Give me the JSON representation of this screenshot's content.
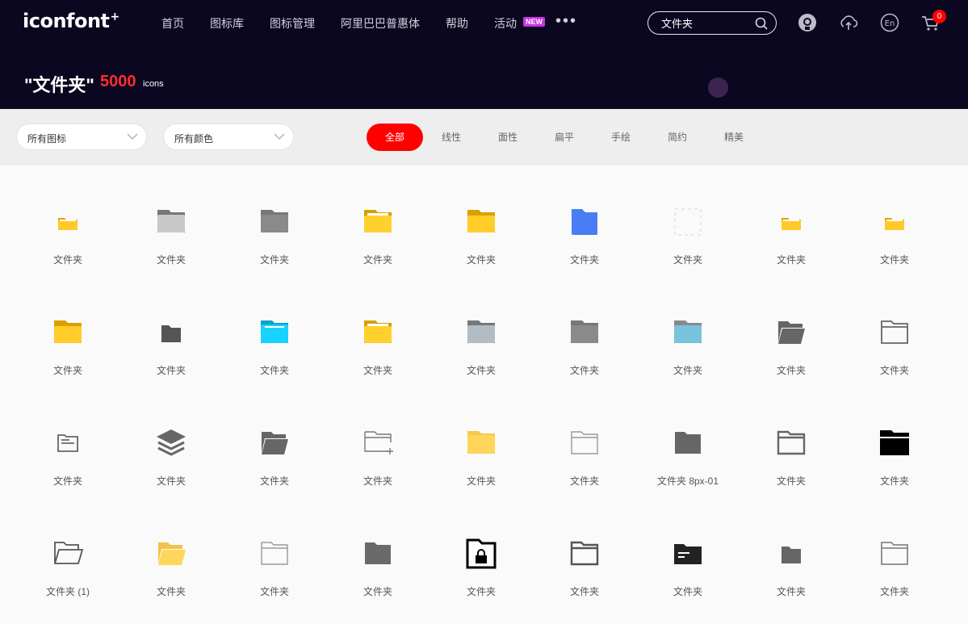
{
  "header": {
    "logo_text": "iconfont",
    "logo_mark": "+",
    "nav": [
      {
        "label": "首页"
      },
      {
        "label": "图标库"
      },
      {
        "label": "图标管理"
      },
      {
        "label": "阿里巴巴普惠体"
      },
      {
        "label": "帮助"
      },
      {
        "label": "活动",
        "badge": "NEW"
      }
    ],
    "more_label": "•••",
    "search": {
      "value": "文件夹",
      "placeholder": ""
    },
    "cart_count": "0",
    "icons": [
      "user-avatar-icon",
      "upload-icon",
      "language-en-icon",
      "cart-icon"
    ]
  },
  "result": {
    "title": "\"文件夹\"",
    "count": "5000",
    "unit": "icons"
  },
  "filters": {
    "icon_select": "所有图标",
    "color_select": "所有颜色",
    "tabs": [
      "全部",
      "线性",
      "面性",
      "扁平",
      "手绘",
      "简约",
      "精美"
    ],
    "active_tab": "全部"
  },
  "icons": [
    {
      "name": "文件夹",
      "icon": "folder-small-yellow",
      "color": "#ffc928"
    },
    {
      "name": "文件夹",
      "icon": "folder-light-gray",
      "color": "#c8c8c8"
    },
    {
      "name": "文件夹",
      "icon": "folder-gray",
      "color": "#8a8a8a"
    },
    {
      "name": "文件夹",
      "icon": "folder-yellow-paper",
      "color": "#ffd12e"
    },
    {
      "name": "文件夹",
      "icon": "folder-yellow",
      "color": "#ffcc29"
    },
    {
      "name": "文件夹",
      "icon": "folder-blue",
      "color": "#4a7df5"
    },
    {
      "name": "文件夹",
      "icon": "folder-transparent",
      "color": "#e8e8e8"
    },
    {
      "name": "文件夹",
      "icon": "folder-small-yellow",
      "color": "#ffc928"
    },
    {
      "name": "文件夹",
      "icon": "folder-small-yellow",
      "color": "#ffc928"
    },
    {
      "name": "文件夹",
      "icon": "folder-yellow-large",
      "color": "#ffcc29"
    },
    {
      "name": "文件夹",
      "icon": "folder-dark-small",
      "color": "#555555"
    },
    {
      "name": "文件夹",
      "icon": "folder-cyan",
      "color": "#18d2ff"
    },
    {
      "name": "文件夹",
      "icon": "folder-yellow-paper",
      "color": "#ffd12e"
    },
    {
      "name": "文件夹",
      "icon": "folder-bluegray",
      "color": "#b2bcc4"
    },
    {
      "name": "文件夹",
      "icon": "folder-gray",
      "color": "#8a8a8a"
    },
    {
      "name": "文件夹",
      "icon": "folder-lightblue",
      "color": "#79c3dd"
    },
    {
      "name": "文件夹",
      "icon": "folder-open-dark",
      "color": "#666666"
    },
    {
      "name": "文件夹",
      "icon": "folder-outline",
      "color": "#666666"
    },
    {
      "name": "文件夹",
      "icon": "folder-doc-outline",
      "color": "#666666"
    },
    {
      "name": "文件夹",
      "icon": "layers",
      "color": "#666666"
    },
    {
      "name": "文件夹",
      "icon": "folder-open-dark",
      "color": "#666666"
    },
    {
      "name": "文件夹",
      "icon": "folder-add-outline",
      "color": "#777777"
    },
    {
      "name": "文件夹",
      "icon": "folder-yellow-soft",
      "color": "#ffd65a"
    },
    {
      "name": "文件夹",
      "icon": "folder-outline-thin",
      "color": "#888888"
    },
    {
      "name": "文件夹 8px-01",
      "icon": "folder-dark-flat",
      "color": "#666666"
    },
    {
      "name": "文件夹",
      "icon": "folder-outline-bold",
      "color": "#666666"
    },
    {
      "name": "文件夹",
      "icon": "folder-black",
      "color": "#000000"
    },
    {
      "name": "文件夹 (1)",
      "icon": "folder-open-outline",
      "color": "#555555"
    },
    {
      "name": "文件夹",
      "icon": "folder-open-yellow",
      "color": "#ffd65a"
    },
    {
      "name": "文件夹",
      "icon": "folder-outline-thin",
      "color": "#888888"
    },
    {
      "name": "文件夹",
      "icon": "folder-dark-flat",
      "color": "#6a6a6a"
    },
    {
      "name": "文件夹",
      "icon": "folder-lock",
      "color": "#000000"
    },
    {
      "name": "文件夹",
      "icon": "folder-outline-bold",
      "color": "#555555"
    },
    {
      "name": "文件夹",
      "icon": "folder-card-black",
      "color": "#222222"
    },
    {
      "name": "文件夹",
      "icon": "folder-dark-small",
      "color": "#666666"
    },
    {
      "name": "文件夹",
      "icon": "folder-outline",
      "color": "#888888"
    }
  ],
  "colors": {
    "header_bg": "#0c0720",
    "accent": "#ff0000",
    "count": "#ff2d2d",
    "new_badge": "#c832e6"
  }
}
